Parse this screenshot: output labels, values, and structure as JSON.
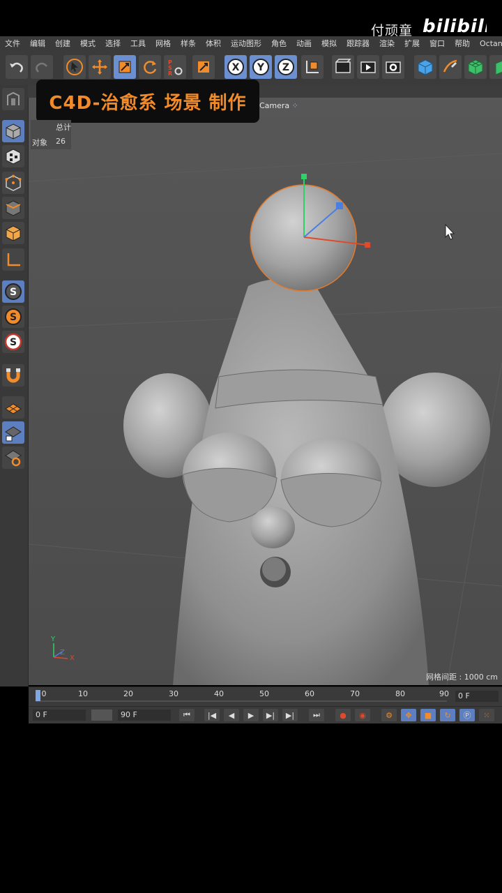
{
  "watermark": {
    "author": "付顽童",
    "logo": "bilibili"
  },
  "menu": [
    "文件",
    "编辑",
    "创建",
    "模式",
    "选择",
    "工具",
    "网格",
    "样条",
    "体积",
    "运动图形",
    "角色",
    "动画",
    "模拟",
    "跟踪器",
    "渲染",
    "扩展",
    "窗口",
    "帮助",
    "Octane"
  ],
  "toolbar_icons": [
    "undo-icon",
    "redo-icon",
    "select-arrow-icon",
    "move-icon",
    "scale-icon",
    "rotate-icon",
    "psr-icon",
    "last-tool-icon",
    "x-axis-icon",
    "y-axis-icon",
    "z-axis-icon",
    "coordinate-system-icon",
    "render-view-icon",
    "render-picture-viewer-icon",
    "render-settings-icon",
    "cube-object-icon",
    "pen-spline-icon",
    "subdivision-icon",
    "extrude-icon"
  ],
  "left_tools": [
    "make-editable-icon",
    "model-mode-icon",
    "texture-mode-icon",
    "points-mode-icon",
    "edges-mode-icon",
    "polygons-mode-icon",
    "axis-mode-icon",
    "solo-icon",
    "solo-hierarchy-icon",
    "solo-off-icon",
    "snap-icon",
    "workplane-icon",
    "locked-workplane-icon",
    "workplane-rotate-icon"
  ],
  "title_badge": "C4D-治愈系 场景 制作",
  "viewport": {
    "camera_label": "Camera",
    "stats": {
      "header": "总计",
      "objects_label": "对象",
      "objects_value": "26"
    },
    "grid_spacing": "网格间距 : 1000 cm",
    "axis_labels": {
      "x": "X",
      "y": "Y",
      "z": "Z"
    }
  },
  "timeline": {
    "ticks": [
      "0",
      "10",
      "20",
      "30",
      "40",
      "50",
      "60",
      "70",
      "80",
      "90"
    ],
    "current_frame": "0 F"
  },
  "playback": {
    "start_field": "0 F",
    "end_field": "90 F",
    "buttons": [
      "go-to-start-icon",
      "prev-key-icon",
      "prev-frame-icon",
      "play-icon",
      "next-frame-icon",
      "next-key-icon",
      "go-to-end-icon",
      "record-icon",
      "autokey-icon",
      "keyframe-settings-icon",
      "move-key-icon",
      "scale-key-icon",
      "rotate-key-icon",
      "param-key-icon",
      "pla-key-icon"
    ]
  },
  "colors": {
    "accent_orange": "#f28b2a",
    "selection_blue": "#6b8fcf",
    "viewport_bg": "#545454"
  }
}
